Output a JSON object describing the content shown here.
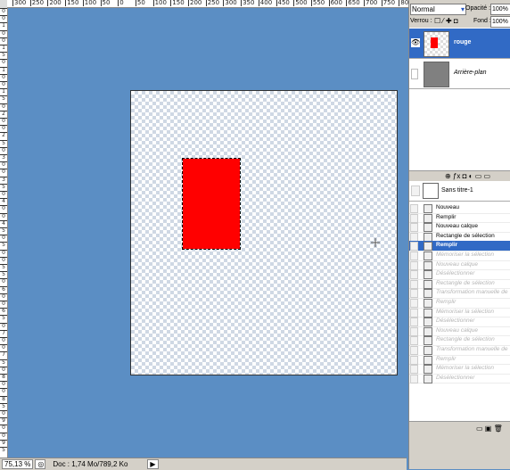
{
  "ruler_top": [
    "300",
    "250",
    "200",
    "150",
    "100",
    "50",
    "0",
    "50",
    "100",
    "150",
    "200",
    "250",
    "300",
    "350",
    "400",
    "450",
    "500",
    "550",
    "600",
    "650",
    "700",
    "750",
    "80"
  ],
  "ruler_left": [
    "0",
    "0",
    "1",
    "0",
    "0",
    "1",
    "5",
    "0",
    "1",
    "0",
    "0",
    "1",
    "5",
    "0",
    "2",
    "0",
    "0",
    "2",
    "5",
    "0",
    "3",
    "0",
    "0",
    "3",
    "5",
    "0",
    "4",
    "0",
    "0",
    "4",
    "5",
    "0",
    "5",
    "0",
    "0",
    "5",
    "5",
    "0",
    "6",
    "0",
    "0",
    "6",
    "5",
    "0",
    "7",
    "0",
    "0",
    "7",
    "5",
    "0",
    "8",
    "0",
    "0",
    "8",
    "5",
    "0",
    "9",
    "0",
    "0",
    "9",
    "5"
  ],
  "status": {
    "zoom": "75,13 %",
    "doc": "Doc : 1,74 Mo/789,2 Ko"
  },
  "layers": {
    "blend_mode": "Normal",
    "opacity_label": "Opacité :",
    "opacity_value": "100%",
    "lock_label": "Verrou :",
    "fill_label": "Fond :",
    "fill_value": "100%",
    "items": [
      {
        "name": "rouge",
        "selected": true
      },
      {
        "name": "Arrière-plan",
        "selected": false
      }
    ]
  },
  "history": {
    "snapshot": "Sans titre-1",
    "items": [
      {
        "label": "Nouveau",
        "state": "normal"
      },
      {
        "label": "Remplir",
        "state": "normal"
      },
      {
        "label": "Nouveau calque",
        "state": "normal"
      },
      {
        "label": "Rectangle de sélection",
        "state": "normal"
      },
      {
        "label": "Remplir",
        "state": "active"
      },
      {
        "label": "Mémoriser la sélection",
        "state": "dim"
      },
      {
        "label": "Nouveau calque",
        "state": "dim"
      },
      {
        "label": "Désélectionner",
        "state": "dim"
      },
      {
        "label": "Rectangle de sélection",
        "state": "dim"
      },
      {
        "label": "Transformation manuelle de l...",
        "state": "dim"
      },
      {
        "label": "Remplir",
        "state": "dim"
      },
      {
        "label": "Mémoriser la sélection",
        "state": "dim"
      },
      {
        "label": "Désélectionner",
        "state": "dim"
      },
      {
        "label": "Nouveau calque",
        "state": "dim"
      },
      {
        "label": "Rectangle de sélection",
        "state": "dim"
      },
      {
        "label": "Transformation manuelle de l...",
        "state": "dim"
      },
      {
        "label": "Remplir",
        "state": "dim"
      },
      {
        "label": "Mémoriser la sélection",
        "state": "dim"
      },
      {
        "label": "Désélectionner",
        "state": "dim"
      }
    ]
  },
  "colors": {
    "workspace": "#5b8ec4",
    "fill": "#ff0000",
    "selection": "#316ac5"
  }
}
